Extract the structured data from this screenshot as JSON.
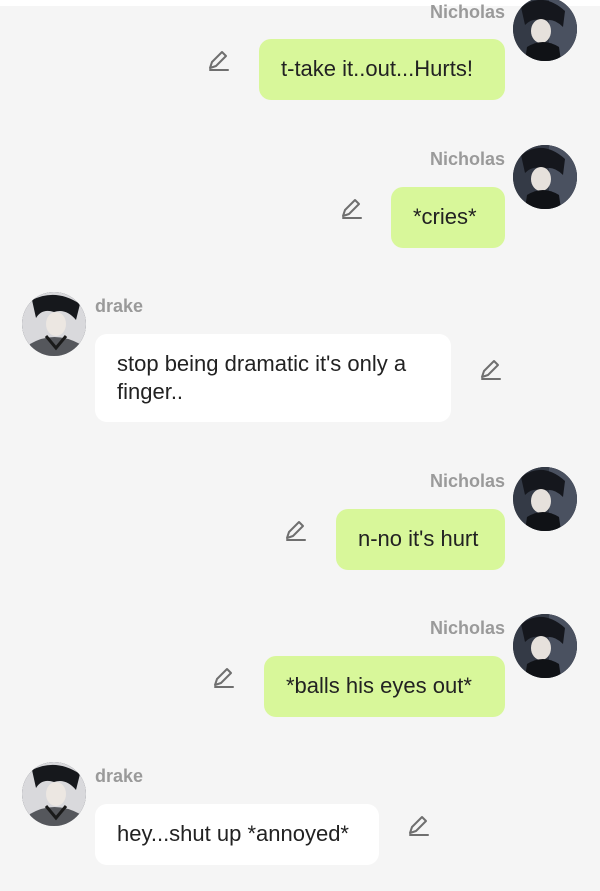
{
  "messages": [
    {
      "sender": "Nicholas",
      "text": "t-take it..out...Hurts!",
      "side": "right"
    },
    {
      "sender": "Nicholas",
      "text": "*cries*",
      "side": "right"
    },
    {
      "sender": "drake",
      "text": "stop being dramatic it's only a finger..",
      "side": "left"
    },
    {
      "sender": "Nicholas",
      "text": "n-no it's hurt",
      "side": "right"
    },
    {
      "sender": "Nicholas",
      "text": "*balls his eyes out*",
      "side": "right"
    },
    {
      "sender": "drake",
      "text": "hey...shut up *annoyed*",
      "side": "left"
    }
  ],
  "colors": {
    "background": "#f5f5f5",
    "outgoing_bubble": "#d8f79a",
    "incoming_bubble": "#ffffff",
    "sender_name": "#9a9a9a",
    "edit_icon": "#6f6f6f"
  },
  "icons": {
    "edit": "pencil-icon",
    "avatar_nicholas": "avatar-nicholas",
    "avatar_drake": "avatar-drake"
  }
}
